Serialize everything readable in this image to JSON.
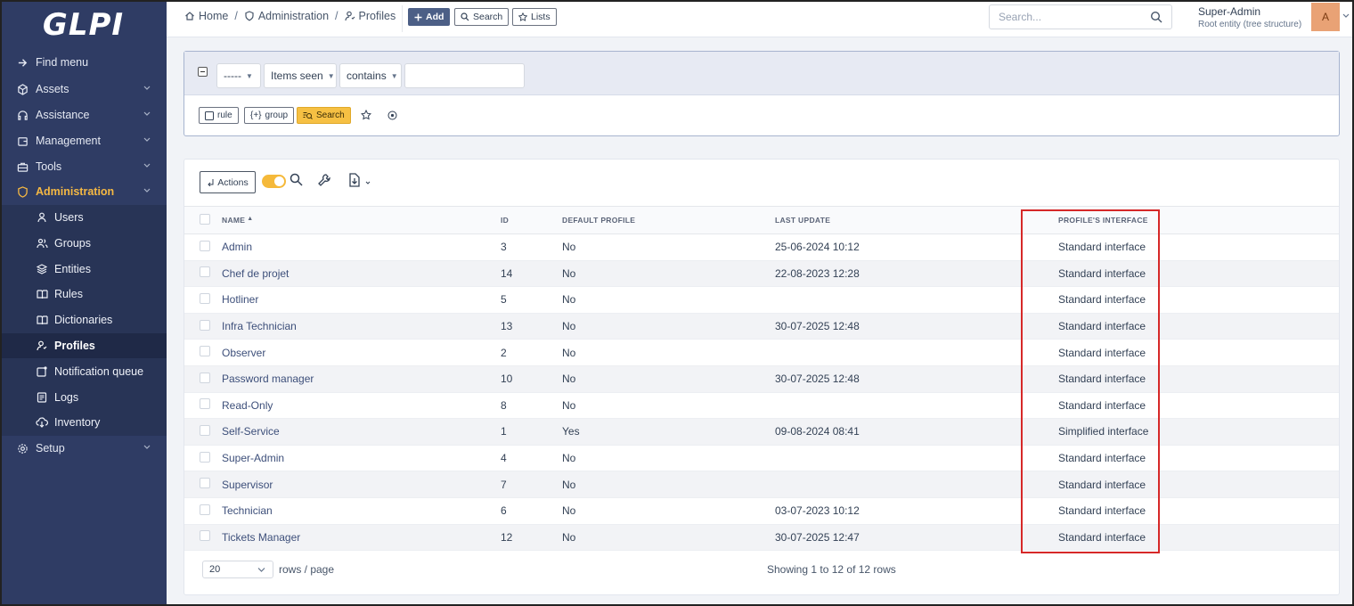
{
  "app": {
    "logo": "GLPI"
  },
  "sidebar": {
    "items": [
      {
        "label": "Find menu",
        "icon": "find-menu-icon"
      },
      {
        "label": "Assets",
        "icon": "cube-icon"
      },
      {
        "label": "Assistance",
        "icon": "headset-icon"
      },
      {
        "label": "Management",
        "icon": "wallet-icon"
      },
      {
        "label": "Tools",
        "icon": "briefcase-icon"
      },
      {
        "label": "Administration",
        "icon": "shield-icon"
      },
      {
        "label": "Setup",
        "icon": "gear-icon"
      }
    ],
    "subitems": [
      {
        "label": "Users",
        "icon": "user-icon"
      },
      {
        "label": "Groups",
        "icon": "users-icon"
      },
      {
        "label": "Entities",
        "icon": "stack-icon"
      },
      {
        "label": "Rules",
        "icon": "book-icon"
      },
      {
        "label": "Dictionaries",
        "icon": "book-icon"
      },
      {
        "label": "Profiles",
        "icon": "profile-icon"
      },
      {
        "label": "Notification queue",
        "icon": "notification-icon"
      },
      {
        "label": "Logs",
        "icon": "log-icon"
      },
      {
        "label": "Inventory",
        "icon": "cloud-download-icon"
      }
    ]
  },
  "breadcrumb": {
    "home": "Home",
    "administration": "Administration",
    "profiles": "Profiles",
    "separator": "/"
  },
  "toolbar": {
    "add": "Add",
    "search": "Search",
    "lists": "Lists"
  },
  "global_search": {
    "placeholder": "Search..."
  },
  "user": {
    "name": "Super-Admin",
    "entity": "Root entity (tree structure)",
    "avatar_initial": "A"
  },
  "criteria": {
    "link_select": "-----",
    "field_select": "Items seen",
    "operator_select": "contains",
    "value": "",
    "rule_button": "rule",
    "group_button": "group",
    "search_button": "Search"
  },
  "results": {
    "actions_label": "Actions",
    "columns": {
      "name": "NAME",
      "id": "ID",
      "default_profile": "DEFAULT PROFILE",
      "last_update": "LAST UPDATE",
      "interface": "PROFILE'S INTERFACE"
    },
    "rows": [
      {
        "name": "Admin",
        "id": "3",
        "default": "No",
        "updated": "25-06-2024 10:12",
        "interface": "Standard interface"
      },
      {
        "name": "Chef de projet",
        "id": "14",
        "default": "No",
        "updated": "22-08-2023 12:28",
        "interface": "Standard interface"
      },
      {
        "name": "Hotliner",
        "id": "5",
        "default": "No",
        "updated": "",
        "interface": "Standard interface"
      },
      {
        "name": "Infra Technician",
        "id": "13",
        "default": "No",
        "updated": "30-07-2025 12:48",
        "interface": "Standard interface"
      },
      {
        "name": "Observer",
        "id": "2",
        "default": "No",
        "updated": "",
        "interface": "Standard interface"
      },
      {
        "name": "Password manager",
        "id": "10",
        "default": "No",
        "updated": "30-07-2025 12:48",
        "interface": "Standard interface"
      },
      {
        "name": "Read-Only",
        "id": "8",
        "default": "No",
        "updated": "",
        "interface": "Standard interface"
      },
      {
        "name": "Self-Service",
        "id": "1",
        "default": "Yes",
        "updated": "09-08-2024 08:41",
        "interface": "Simplified interface"
      },
      {
        "name": "Super-Admin",
        "id": "4",
        "default": "No",
        "updated": "",
        "interface": "Standard interface"
      },
      {
        "name": "Supervisor",
        "id": "7",
        "default": "No",
        "updated": "",
        "interface": "Standard interface"
      },
      {
        "name": "Technician",
        "id": "6",
        "default": "No",
        "updated": "03-07-2023 10:12",
        "interface": "Standard interface"
      },
      {
        "name": "Tickets Manager",
        "id": "12",
        "default": "No",
        "updated": "30-07-2025 12:47",
        "interface": "Standard interface"
      }
    ],
    "page_size": "20",
    "rows_per_page_label": "rows / page",
    "showing": "Showing 1 to 12 of 12 rows"
  },
  "colors": {
    "sidebar_bg": "#2f3c64",
    "accent": "#f5b843",
    "link": "#3d4f7a",
    "highlight": "#d62828"
  }
}
